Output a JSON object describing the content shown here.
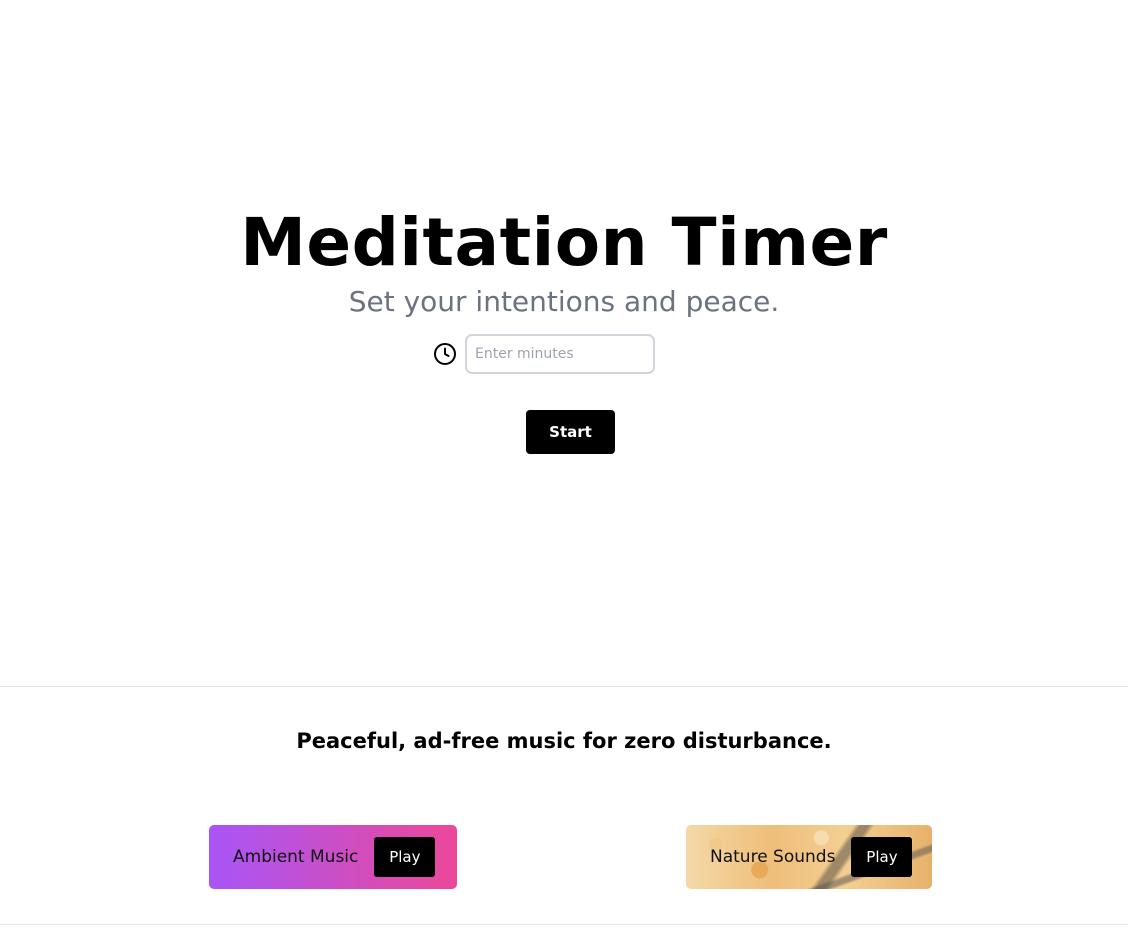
{
  "hero": {
    "title": "Meditation Timer",
    "subtitle": "Set your intentions and peace."
  },
  "timer": {
    "icon": "clock-icon",
    "input_placeholder": "Enter minutes",
    "input_value": "",
    "start_label": "Start"
  },
  "music": {
    "heading": "Peaceful, ad-free music for zero disturbance.",
    "cards": [
      {
        "label": "Ambient Music",
        "play_label": "Play",
        "gradient_from": "#a855f7",
        "gradient_to": "#ec4899"
      },
      {
        "label": "Nature Sounds",
        "play_label": "Play"
      }
    ]
  }
}
